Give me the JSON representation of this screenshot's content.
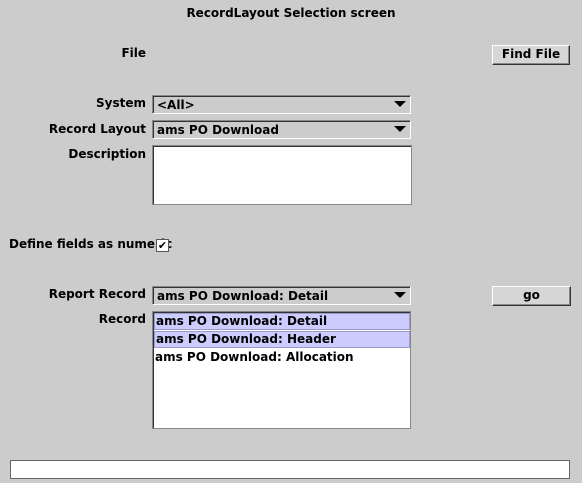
{
  "screen": {
    "title": "RecordLayout Selection screen"
  },
  "file": {
    "label": "File",
    "button_label": "Find File"
  },
  "system": {
    "label": "System",
    "value": "<All>"
  },
  "record_layout": {
    "label": "Record Layout",
    "value": "ams PO Download"
  },
  "description": {
    "label": "Description",
    "value": ""
  },
  "numeric": {
    "label": "Define fields as numeric",
    "checked_glyph": "✔"
  },
  "report_record": {
    "label": "Report Record",
    "value": "ams PO Download: Detail",
    "go_label": "go"
  },
  "record": {
    "label": "Record",
    "items": [
      {
        "text": "ams PO Download: Detail",
        "selected": true
      },
      {
        "text": "ams PO Download: Header",
        "selected": true
      },
      {
        "text": "ams PO Download: Allocation",
        "selected": false
      }
    ]
  },
  "status_bar": {
    "text": ""
  },
  "colors": {
    "background": "#cccccc",
    "selection": "#ccccff"
  }
}
